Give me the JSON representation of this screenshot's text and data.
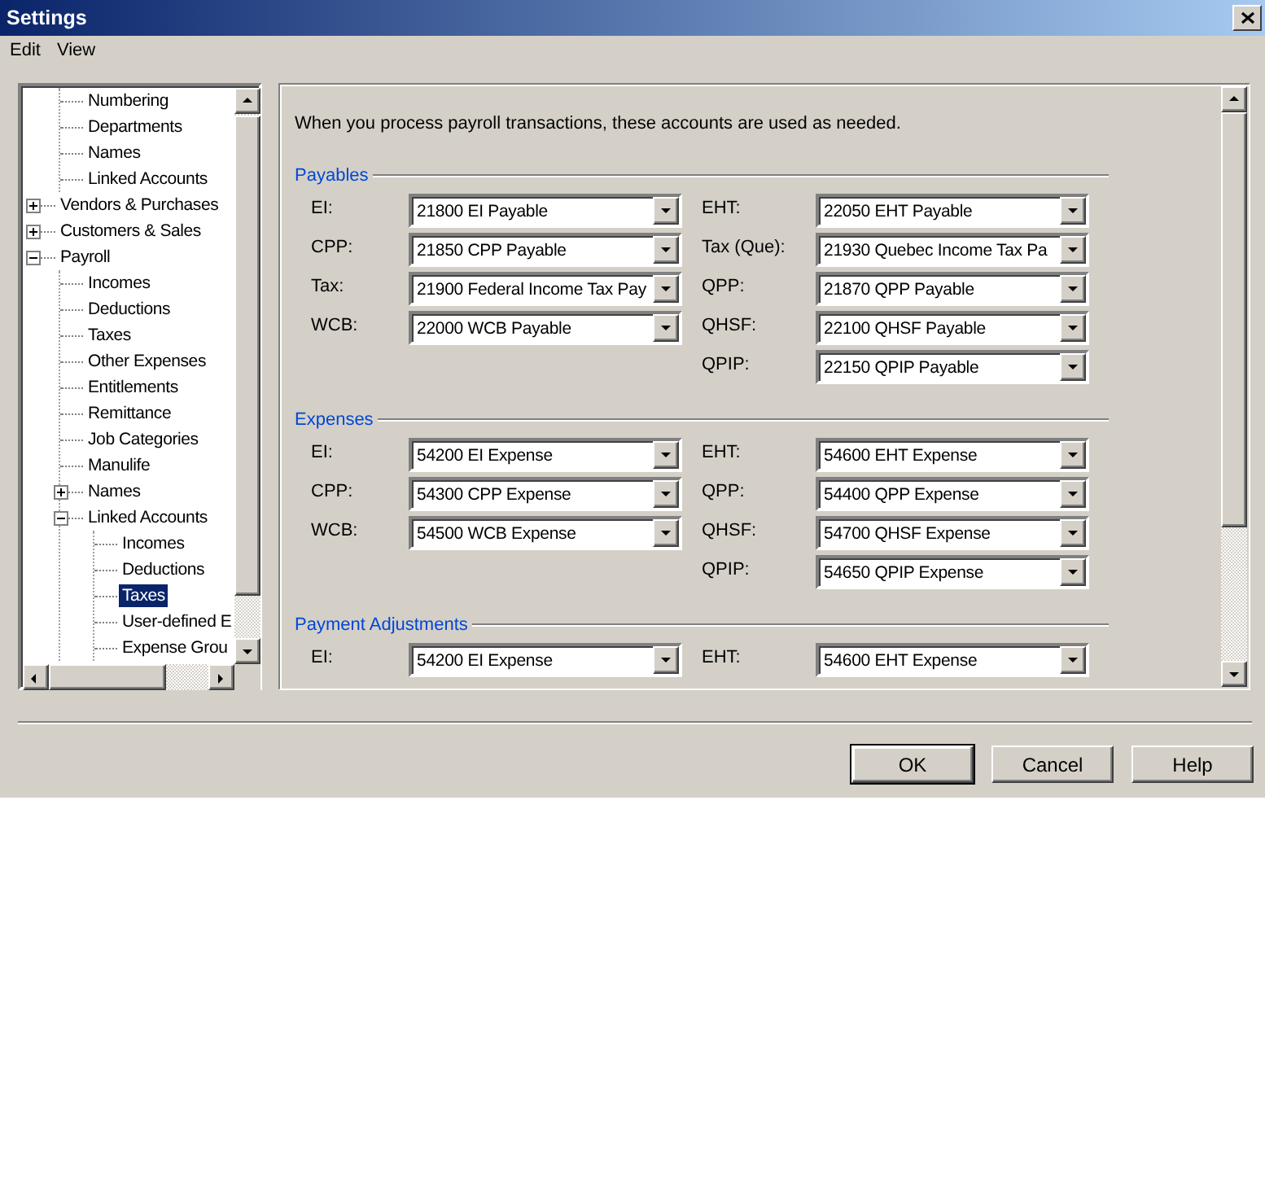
{
  "window": {
    "title": "Settings"
  },
  "menu": [
    {
      "label": "Edit"
    },
    {
      "label": "View"
    }
  ],
  "tree": [
    {
      "children": [
        {
          "label": "Numbering",
          "selected": false
        },
        {
          "label": "Departments",
          "selected": false
        },
        {
          "label": "Names",
          "selected": false
        },
        {
          "label": "Linked Accounts",
          "selected": false
        }
      ]
    },
    {
      "label": "Vendors & Purchases",
      "selected": false,
      "expanded": false
    },
    {
      "label": "Customers & Sales",
      "selected": false,
      "expanded": false
    },
    {
      "label": "Payroll",
      "selected": false,
      "expanded": true,
      "children": [
        {
          "label": "Incomes",
          "selected": false
        },
        {
          "label": "Deductions",
          "selected": false
        },
        {
          "label": "Taxes",
          "selected": false
        },
        {
          "label": "Other Expenses",
          "selected": false
        },
        {
          "label": "Entitlements",
          "selected": false
        },
        {
          "label": "Remittance",
          "selected": false
        },
        {
          "label": "Job Categories",
          "selected": false
        },
        {
          "label": "Manulife",
          "selected": false
        },
        {
          "label": "Names",
          "selected": false,
          "expanded": false
        },
        {
          "label": "Linked Accounts",
          "selected": false,
          "expanded": true,
          "children": [
            {
              "label": "Incomes",
              "selected": false
            },
            {
              "label": "Deductions",
              "selected": false
            },
            {
              "label": "Taxes",
              "selected": true
            },
            {
              "label": "User-defined E",
              "selected": false
            },
            {
              "label": "Expense Grou",
              "selected": false
            }
          ]
        }
      ]
    }
  ],
  "intro": "When you process payroll transactions, these accounts are used as needed.",
  "sections": [
    {
      "title": "Payables",
      "left": [
        {
          "label": "EI:",
          "value": "21800 EI Payable"
        },
        {
          "label": "CPP:",
          "value": "21850 CPP Payable"
        },
        {
          "label": "Tax:",
          "value": "21900 Federal Income Tax Pay"
        },
        {
          "label": "WCB:",
          "value": "22000 WCB Payable"
        }
      ],
      "right": [
        {
          "label": "EHT:",
          "value": "22050 EHT Payable"
        },
        {
          "label": "Tax (Que):",
          "value": "21930 Quebec Income Tax Pa"
        },
        {
          "label": "QPP:",
          "value": "21870 QPP Payable"
        },
        {
          "label": "QHSF:",
          "value": "22100 QHSF Payable"
        },
        {
          "label": "QPIP:",
          "value": "22150 QPIP Payable"
        }
      ]
    },
    {
      "title": "Expenses",
      "left": [
        {
          "label": "EI:",
          "value": "54200 EI Expense"
        },
        {
          "label": "CPP:",
          "value": "54300 CPP Expense"
        },
        {
          "label": "WCB:",
          "value": "54500 WCB Expense"
        }
      ],
      "right": [
        {
          "label": "EHT:",
          "value": "54600 EHT Expense"
        },
        {
          "label": "QPP:",
          "value": "54400 QPP Expense"
        },
        {
          "label": "QHSF:",
          "value": "54700 QHSF Expense"
        },
        {
          "label": "QPIP:",
          "value": "54650 QPIP Expense"
        }
      ]
    },
    {
      "title": "Payment Adjustments",
      "left": [
        {
          "label": "EI:",
          "value": "54200 EI Expense"
        }
      ],
      "right": [
        {
          "label": "EHT:",
          "value": "54600 EHT Expense"
        }
      ]
    }
  ],
  "buttons": [
    {
      "label": "OK",
      "default": true
    },
    {
      "label": "Cancel",
      "default": false
    },
    {
      "label": "Help",
      "default": false
    }
  ]
}
